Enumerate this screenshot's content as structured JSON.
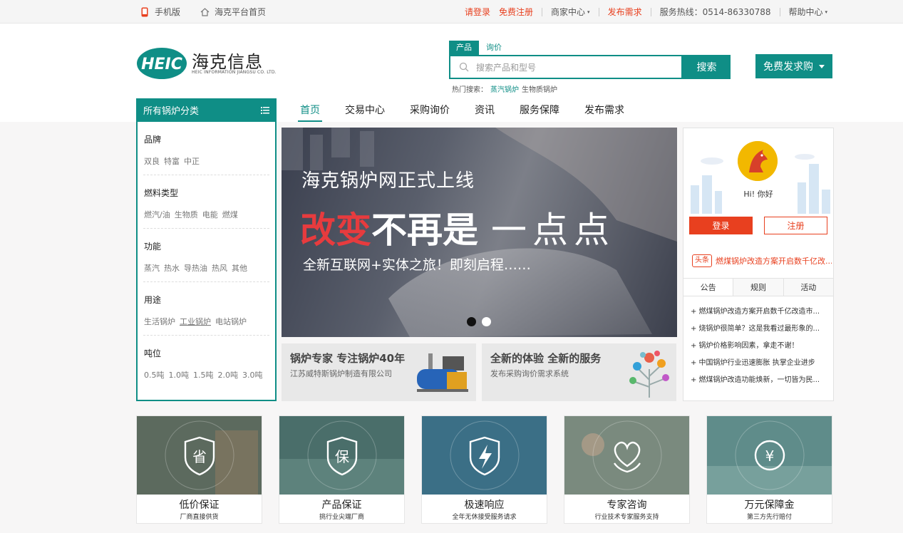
{
  "topbar": {
    "mobile": "手机版",
    "home": "海克平台首页",
    "login": "请登录",
    "register": "免费注册",
    "merchant": "商家中心",
    "publish": "发布需求",
    "hotline": "服务热线：0514-86330788",
    "help": "帮助中心"
  },
  "logo": {
    "mark": "HEIC",
    "name": "海克信息",
    "sub": "HEIC INFORMATION JIANGSU CO. LTD."
  },
  "search": {
    "tabs": [
      "产品",
      "询价"
    ],
    "placeholder": "搜索产品和型号",
    "button": "搜索",
    "hot_label": "热门搜索：",
    "hot_items": [
      "蒸汽锅炉",
      "生物质锅炉"
    ]
  },
  "free_button": "免费发求购",
  "nav": [
    "首页",
    "交易中心",
    "采购询价",
    "资讯",
    "服务保障",
    "发布需求"
  ],
  "categories": {
    "title": "所有锅炉分类",
    "groups": [
      {
        "title": "品牌",
        "items": [
          "双良",
          "特富",
          "中正"
        ]
      },
      {
        "title": "燃料类型",
        "items": [
          "燃汽/油",
          "生物质",
          "电能",
          "燃煤"
        ]
      },
      {
        "title": "功能",
        "items": [
          "蒸汽",
          "热水",
          "导热油",
          "热风",
          "其他"
        ]
      },
      {
        "title": "用途",
        "items": [
          "生活锅炉",
          "工业锅炉",
          "电站锅炉"
        ]
      },
      {
        "title": "吨位",
        "items": [
          "0.5吨",
          "1.0吨",
          "1.5吨",
          "2.0吨",
          "3.0吨"
        ]
      }
    ]
  },
  "banner": {
    "line1": "海克锅炉网正式上线",
    "line2_red": "改变",
    "line2_white": "不再是",
    "line2_thin": "一点点",
    "line3": "全新互联网+实体之旅！即刻启程……"
  },
  "promos": [
    {
      "title": "锅炉专家 专注锅炉40年",
      "sub": "江苏威特斯锅炉制造有限公司"
    },
    {
      "title": "全新的体验 全新的服务",
      "sub": "发布采购询价需求系统"
    }
  ],
  "user": {
    "greeting": "Hi! 你好",
    "login": "登录",
    "register": "注册"
  },
  "headline": {
    "tag": "头条",
    "text": "燃煤锅炉改造方案开启数千亿改..."
  },
  "notice_tabs": [
    "公告",
    "规则",
    "活动"
  ],
  "notices": [
    "+ 燃煤锅炉改造方案开启数千亿改造市...",
    "+ 烧锅炉很简单？这是我看过最形象的...",
    "+ 锅炉价格影响因素，拿走不谢！",
    "+ 中国锅炉行业迅速膨胀 执掌企业进步",
    "+ 燃煤锅炉改造功能焕新，一切皆为民..."
  ],
  "services": [
    {
      "glyph": "省",
      "title": "低价保证",
      "sub": "厂商直接供货",
      "icon": "save-shield-icon"
    },
    {
      "glyph": "保",
      "title": "产品保证",
      "sub": "挑行业尖端厂商",
      "icon": "guarantee-shield-icon"
    },
    {
      "glyph": "",
      "title": "极速响应",
      "sub": "全年无休接受服务请求",
      "icon": "lightning-shield-icon"
    },
    {
      "glyph": "",
      "title": "专家咨询",
      "sub": "行业技术专家服务支持",
      "icon": "heart-hands-icon"
    },
    {
      "glyph": "¥",
      "title": "万元保障金",
      "sub": "第三方先行赔付",
      "icon": "yuan-circle-icon"
    }
  ],
  "colors": {
    "accent": "#0f8e86",
    "red": "#e8401f"
  }
}
